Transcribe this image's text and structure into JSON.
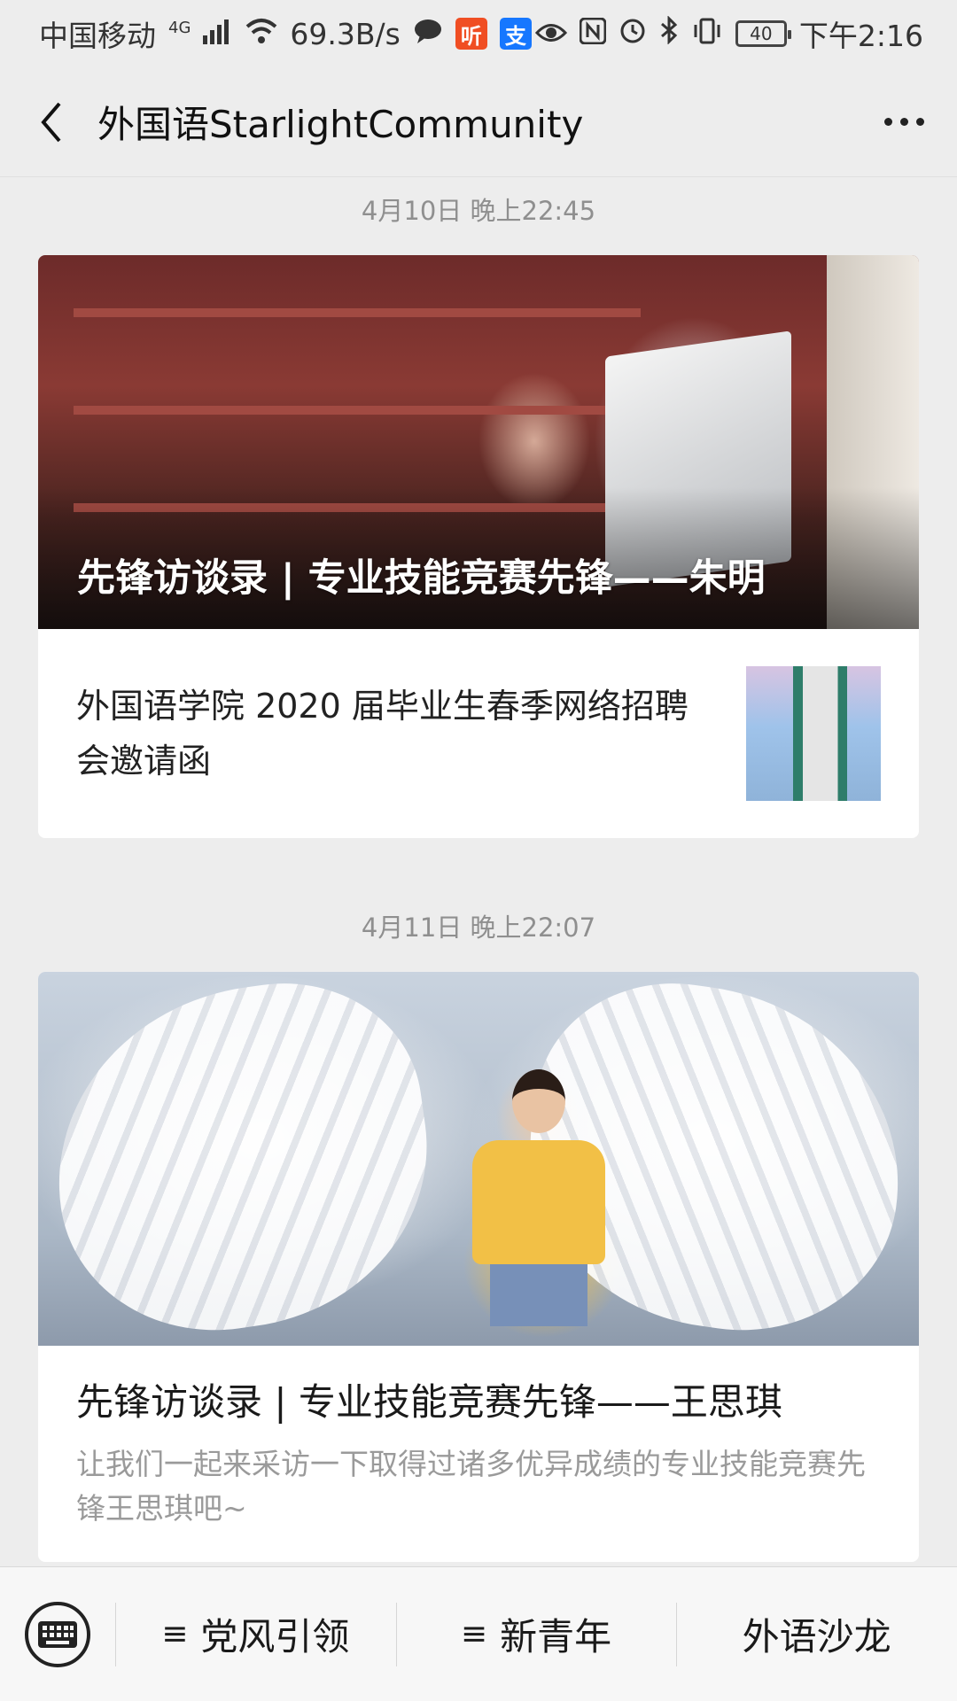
{
  "status_bar": {
    "carrier": "中国移动",
    "network": "4G",
    "speed": "69.3B/s",
    "app_badge_1": "听",
    "app_badge_2": "支",
    "battery": "40",
    "time": "下午2:16"
  },
  "nav": {
    "title": "外国语StarlightCommunity"
  },
  "messages": [
    {
      "timestamp": "4月10日 晚上22:45",
      "cover_title": "先锋访谈录 | 专业技能竞赛先锋——朱明",
      "sub_item_title": "外国语学院 2020 届毕业生春季网络招聘会邀请函"
    },
    {
      "timestamp": "4月11日 晚上22:07",
      "article_title": "先锋访谈录 | 专业技能竞赛先锋——王思琪",
      "article_desc": "让我们一起来采访一下取得过诸多优异成绩的专业技能竞赛先锋王思琪吧~"
    }
  ],
  "bottom_menu": {
    "items": [
      {
        "label": "党风引领",
        "has_submenu": true
      },
      {
        "label": "新青年",
        "has_submenu": true
      },
      {
        "label": "外语沙龙",
        "has_submenu": false
      }
    ]
  },
  "colors": {
    "background": "#ededed",
    "card": "#ffffff",
    "timestamp": "#8f8f8f",
    "desc": "#9a9a9a"
  }
}
